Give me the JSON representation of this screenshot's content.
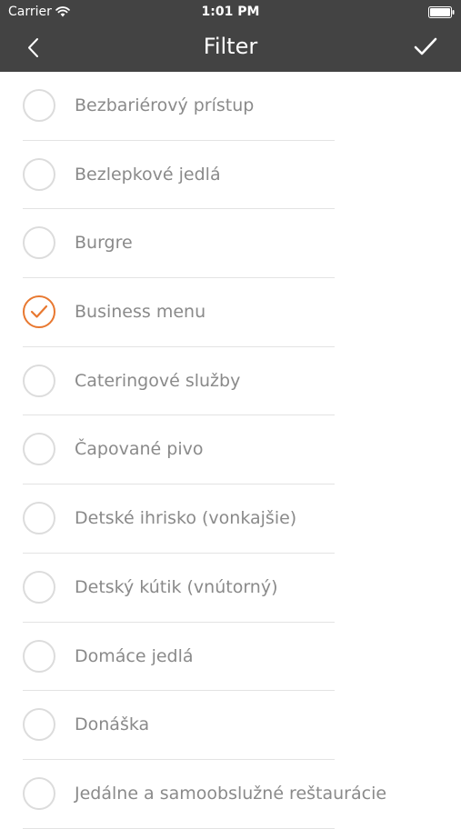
{
  "status_bar": {
    "carrier": "Carrier",
    "time": "1:01 PM"
  },
  "nav": {
    "title": "Filter"
  },
  "colors": {
    "header_bg": "#434343",
    "accent": "#e87830",
    "label": "#8a8a8a"
  },
  "filters": [
    {
      "label": "Bezbariérový prístup",
      "checked": false
    },
    {
      "label": "Bezlepkové jedlá",
      "checked": false
    },
    {
      "label": "Burgre",
      "checked": false
    },
    {
      "label": "Business menu",
      "checked": true
    },
    {
      "label": "Cateringové služby",
      "checked": false
    },
    {
      "label": "Čapované pivo",
      "checked": false
    },
    {
      "label": "Detské ihrisko (vonkajšie)",
      "checked": false
    },
    {
      "label": "Detský kútik (vnútorný)",
      "checked": false
    },
    {
      "label": "Domáce jedlá",
      "checked": false
    },
    {
      "label": "Donáška",
      "checked": false
    },
    {
      "label": "Jedálne a samoobslužné reštaurácie",
      "checked": false
    }
  ]
}
